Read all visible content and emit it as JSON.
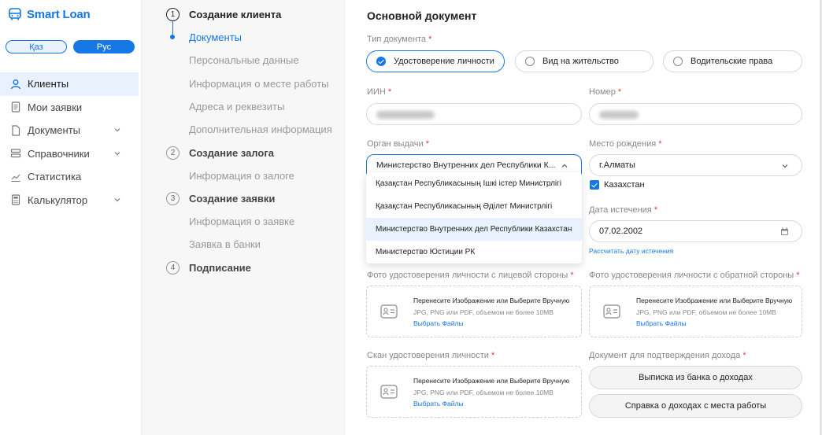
{
  "app": {
    "logo_text": "Smart Loan"
  },
  "lang": {
    "kaz": "Қаз",
    "rus": "Рус"
  },
  "nav": {
    "items": [
      {
        "label": "Клиенты",
        "icon": "user-icon"
      },
      {
        "label": "Мои заявки",
        "icon": "document-list-icon"
      },
      {
        "label": "Документы",
        "icon": "file-icon"
      },
      {
        "label": "Справочники",
        "icon": "database-icon"
      },
      {
        "label": "Статистика",
        "icon": "chart-icon"
      },
      {
        "label": "Калькулятор",
        "icon": "calculator-icon"
      }
    ]
  },
  "stepper": {
    "s1": {
      "num": "1",
      "title": "Создание клиента"
    },
    "s1_sub": [
      "Документы",
      "Персональные данные",
      "Информация о месте работы",
      "Адреса и реквезиты",
      "Дополнительная информация"
    ],
    "s2": {
      "num": "2",
      "title": "Создание залога"
    },
    "s2_sub": [
      "Информация о залоге"
    ],
    "s3": {
      "num": "3",
      "title": "Создание заявки"
    },
    "s3_sub": [
      "Информация о заявке",
      "Заявка в банки"
    ],
    "s4": {
      "num": "4",
      "title": "Подписание"
    }
  },
  "form": {
    "section_title": "Основной документ",
    "doc_type_label": "Тип документа",
    "doc_types": [
      "Удостоверение личности",
      "Вид на жительство",
      "Водительские права"
    ],
    "iin_label": "ИИН",
    "number_label": "Номер",
    "issuer_label": "Орган выдачи",
    "issuer_value": "Министерство Внутренних дел Республики К...",
    "issuer_options": [
      "Қазақстан Республикасының Ішкі істер Министрлігі",
      "Қазақстан Республикасының Әділет Министрлігі",
      "Министерство Внутренних дел Республики Казахстан",
      "Министерство Юстиции РК"
    ],
    "birthplace_label": "Место рождения",
    "birthplace_value": "г.Алматы",
    "kz_checkbox": "Казахстан",
    "expiry_label": "Дата истечения",
    "expiry_value": "07.02.2002",
    "calc_expiry_link": "Рассчитать дату истечения",
    "photo_front_label": "Фото удостоверения личности с лицевой стороны",
    "photo_back_label": "Фото удостоверения личности с обратной стороны",
    "scan_label": "Скан удостоверения личности",
    "income_label": "Документ для подтверждения дохода",
    "upload_title": "Перенесите Изображение или Выберите Вручную",
    "upload_hint": "JPG, PNG или PDF, объемом не более 10MB",
    "upload_link": "Выбрать Файлы",
    "income_btn_1": "Выписка из банка о доходах",
    "income_btn_2": "Справка о доходах с места работы",
    "req": "*"
  },
  "colors": {
    "accent": "#1677e6",
    "required": "#e53935"
  }
}
